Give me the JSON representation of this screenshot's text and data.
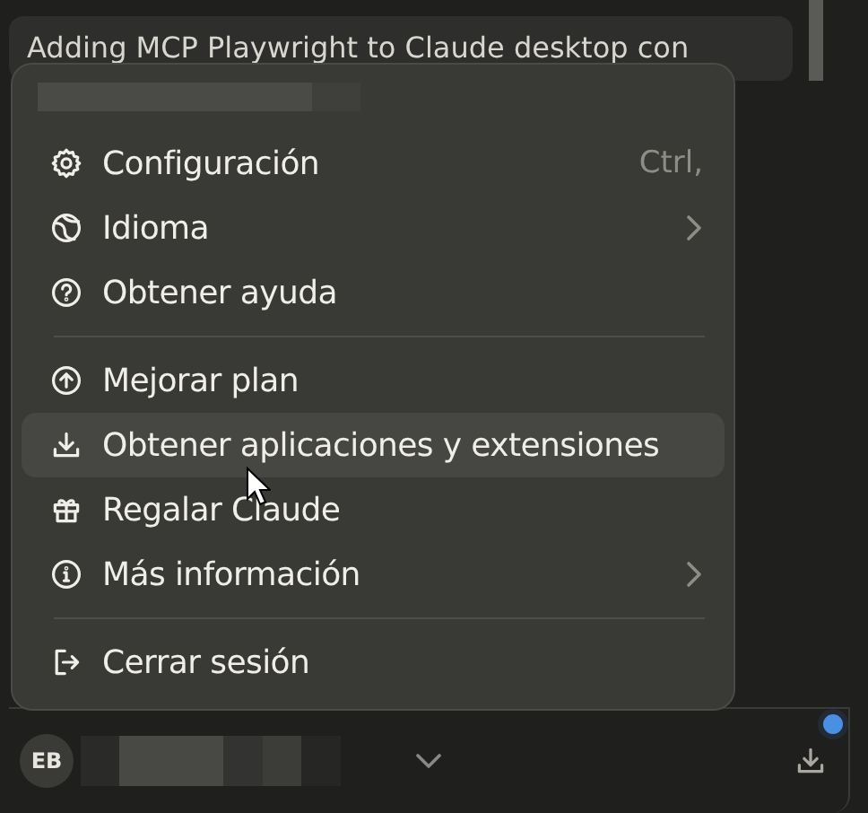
{
  "recent_chat": {
    "title": "Adding MCP Playwright to Claude desktop con"
  },
  "menu": {
    "items": [
      {
        "kind": "item",
        "label": "Configuración",
        "shortcut": "Ctrl,",
        "submenu": false,
        "selected": false
      },
      {
        "kind": "item",
        "label": "Idioma",
        "submenu": true,
        "selected": false
      },
      {
        "kind": "item",
        "label": "Obtener ayuda",
        "submenu": false,
        "selected": false
      },
      {
        "kind": "divider"
      },
      {
        "kind": "item",
        "label": "Mejorar plan",
        "submenu": false,
        "selected": false
      },
      {
        "kind": "item",
        "label": "Obtener aplicaciones y extensiones",
        "submenu": false,
        "selected": true
      },
      {
        "kind": "item",
        "label": "Regalar Claude",
        "submenu": false,
        "selected": false
      },
      {
        "kind": "item",
        "label": "Más información",
        "submenu": true,
        "selected": false
      },
      {
        "kind": "divider"
      },
      {
        "kind": "item",
        "label": "Cerrar sesión",
        "submenu": false,
        "selected": false
      }
    ]
  },
  "account": {
    "initials": "EB",
    "update_available": true
  }
}
